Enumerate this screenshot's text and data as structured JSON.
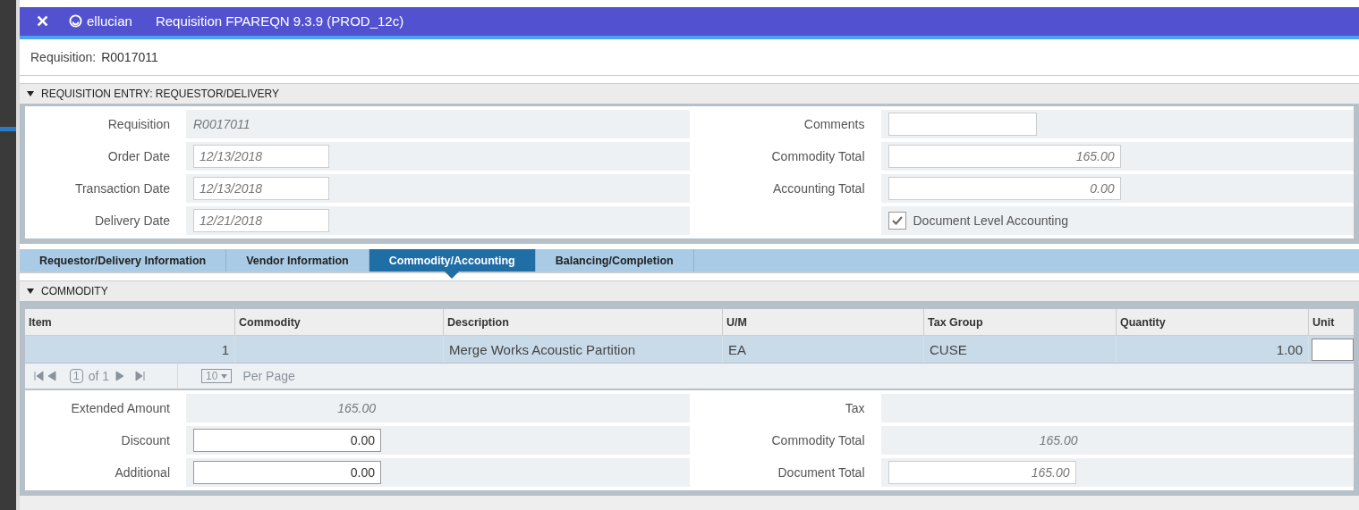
{
  "window": {
    "title": "Requisition FPAREQN 9.3.9 (PROD_12c)",
    "brand": "ellucian",
    "close_icon": "✕"
  },
  "key_block": {
    "label": "Requisition:",
    "value": "R0017011"
  },
  "entry_section": {
    "title": "REQUISITION ENTRY: REQUESTOR/DELIVERY",
    "expanded": true,
    "left": [
      {
        "label": "Requisition",
        "value": "R0017011",
        "kind": "readonly"
      },
      {
        "label": "Order Date",
        "value": "12/13/2018",
        "kind": "input"
      },
      {
        "label": "Transaction Date",
        "value": "12/13/2018",
        "kind": "input"
      },
      {
        "label": "Delivery Date",
        "value": "12/21/2018",
        "kind": "input"
      }
    ],
    "right": [
      {
        "label": "Comments",
        "kind": "input"
      },
      {
        "label": "Commodity Total",
        "value": "165.00",
        "kind": "input"
      },
      {
        "label": "Accounting Total",
        "value": "0.00",
        "kind": "input"
      },
      {
        "label": "Document Level Accounting",
        "kind": "checkbox",
        "checked": true
      }
    ]
  },
  "tabs": [
    {
      "label": "Requestor/Delivery Information",
      "selected": false
    },
    {
      "label": "Vendor Information",
      "selected": false
    },
    {
      "label": "Commodity/Accounting",
      "selected": true
    },
    {
      "label": "Balancing/Completion",
      "selected": false
    }
  ],
  "commodity_section": {
    "title": "COMMODITY",
    "expanded": true,
    "table": {
      "columns": [
        "Item",
        "Commodity",
        "Description",
        "U/M",
        "Tax Group",
        "Quantity",
        "Unit"
      ],
      "rows": [
        {
          "selected": true,
          "cells": [
            "1",
            "",
            "Merge Works Acoustic Partition",
            "EA",
            "CUSE",
            "1.00",
            ""
          ]
        }
      ]
    },
    "pager": {
      "page": "1",
      "of": "of 1",
      "per_page": "10",
      "per_page_label": "Per Page",
      "disabled": true
    },
    "left": [
      {
        "label": "Extended Amount",
        "value": "165.00",
        "kind": "readonly"
      },
      {
        "label": "Discount",
        "value": "0.00",
        "kind": "input"
      },
      {
        "label": "Additional",
        "value": "0.00",
        "kind": "input"
      }
    ],
    "right": [
      {
        "label": "Tax",
        "kind": "readonly"
      },
      {
        "label": "Commodity Total",
        "value": "165.00",
        "kind": "readonly"
      },
      {
        "label": "Document Total",
        "value": "165.00",
        "kind": "input"
      }
    ]
  }
}
